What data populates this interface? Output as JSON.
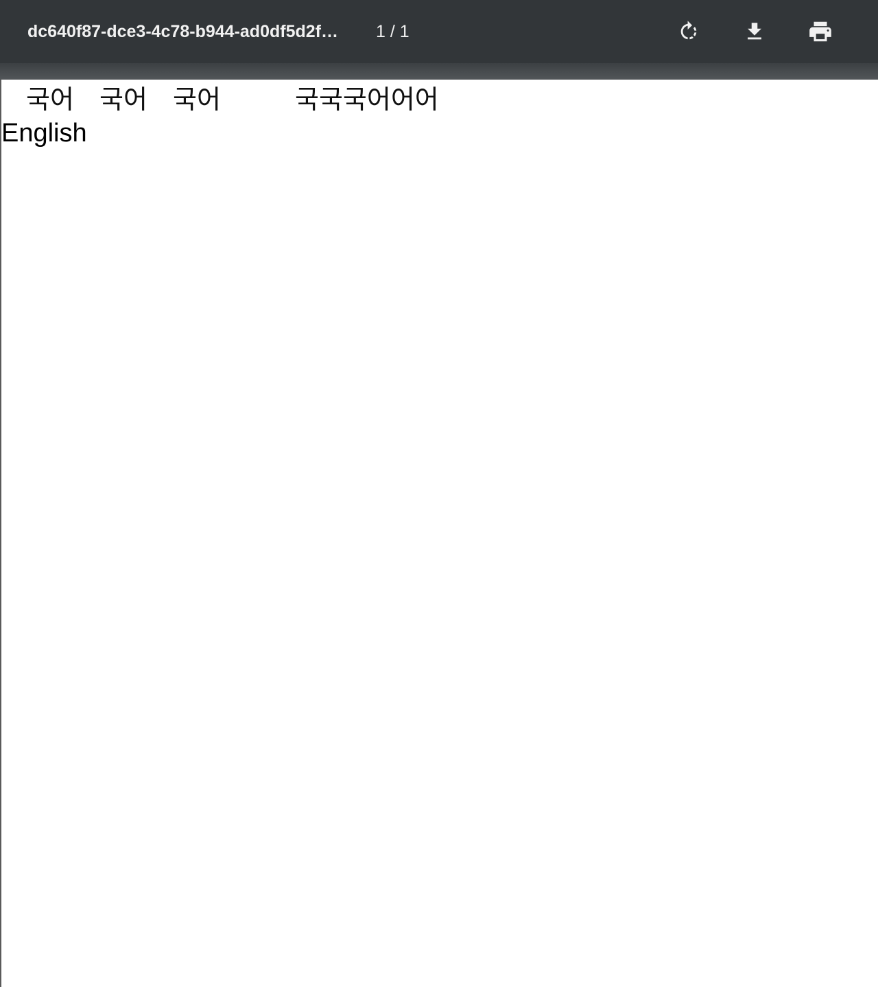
{
  "toolbar": {
    "title": "dc640f87-dce3-4c78-b944-ad0df5d2f…",
    "page_counter": "1 / 1",
    "buttons": [
      {
        "name": "rotate",
        "icon": "rotate-clockwise-icon"
      },
      {
        "name": "download",
        "icon": "download-icon"
      },
      {
        "name": "print",
        "icon": "print-icon"
      }
    ]
  },
  "page": {
    "korean_segments": [
      "국어",
      "국어",
      "국어",
      "국국국어어어"
    ],
    "english_text": "English"
  },
  "colors": {
    "toolbar_bg": "#323639",
    "toolbar_text": "#f1f1f1",
    "viewer_bg": "#525659",
    "page_bg": "#ffffff"
  }
}
